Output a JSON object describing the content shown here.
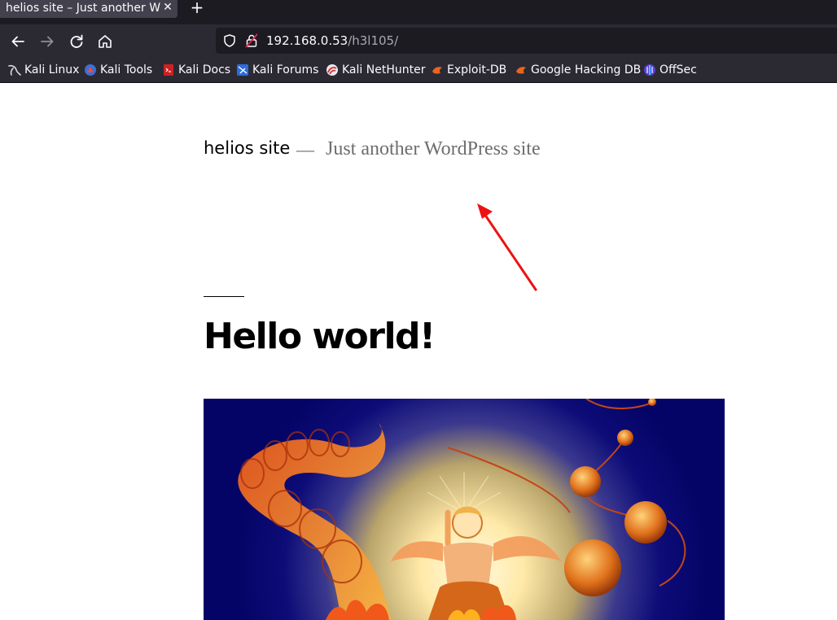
{
  "browser": {
    "tab": {
      "title": "helios site – Just another WordPress site"
    },
    "url": {
      "host": "192.168.0.53",
      "path": "/h3l105/"
    },
    "bookmarks": [
      {
        "label": "Kali Linux",
        "icon": "kali-dragon-icon"
      },
      {
        "label": "Kali Tools",
        "icon": "kali-tools-icon"
      },
      {
        "label": "Kali Docs",
        "icon": "kali-docs-icon"
      },
      {
        "label": "Kali Forums",
        "icon": "kali-forums-icon"
      },
      {
        "label": "Kali NetHunter",
        "icon": "kali-nethunter-icon"
      },
      {
        "label": "Exploit-DB",
        "icon": "exploit-db-icon"
      },
      {
        "label": "Google Hacking DB",
        "icon": "ghdb-icon"
      },
      {
        "label": "OffSec",
        "icon": "offsec-icon"
      }
    ]
  },
  "page": {
    "site_title": "helios site",
    "separator": "—",
    "site_description": "Just another WordPress site",
    "post_title": "Hello world!",
    "featured_image": "helios-sun-god-illustration"
  },
  "colors": {
    "annotation_arrow": "#ee1111",
    "browser_chrome": "#2b2a33"
  }
}
